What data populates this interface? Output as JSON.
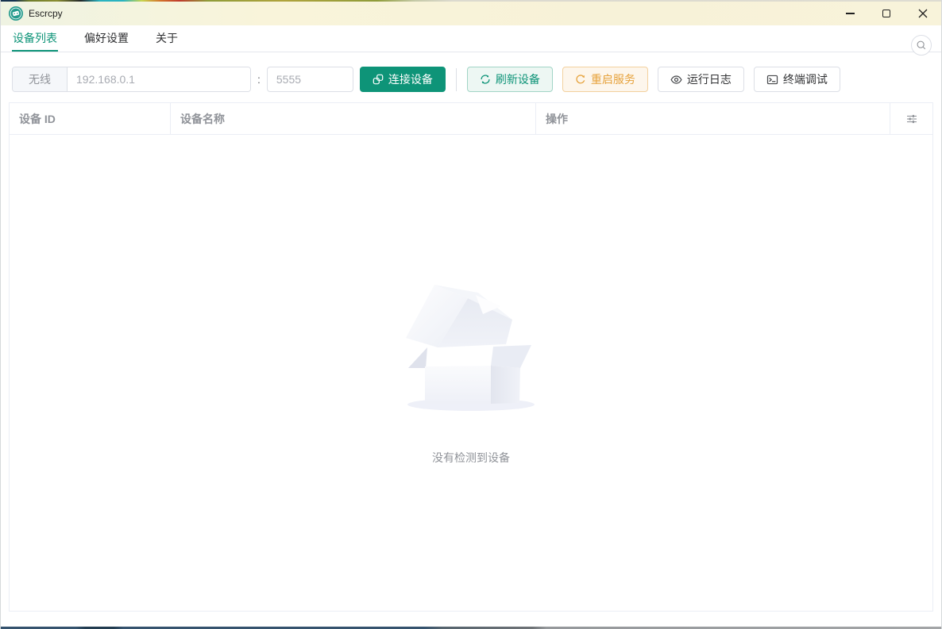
{
  "window": {
    "title": "Escrcpy"
  },
  "tabs": [
    {
      "label": "设备列表",
      "active": true
    },
    {
      "label": "偏好设置",
      "active": false
    },
    {
      "label": "关于",
      "active": false
    }
  ],
  "toolbar": {
    "wireless_label": "无线",
    "ip_value": "192.168.0.1",
    "port_separator": ":",
    "port_value": "5555",
    "connect_label": "连接设备",
    "refresh_label": "刷新设备",
    "restart_label": "重启服务",
    "logs_label": "运行日志",
    "terminal_label": "终端调试"
  },
  "table": {
    "columns": [
      {
        "label": "设备 ID"
      },
      {
        "label": "设备名称"
      },
      {
        "label": "操作"
      }
    ]
  },
  "empty_state": {
    "description": "没有检测到设备"
  },
  "icons": {
    "app_logo": "escrcpy-logo",
    "connect": "link-icon",
    "refresh": "refresh-arrows-icon",
    "restart": "refresh-right-icon",
    "logs": "eye-icon",
    "terminal": "terminal-window-icon",
    "search": "magnifier-icon",
    "column_settings": "sliders-icon"
  },
  "colors": {
    "primary": "#0e9478",
    "success_bg": "#edf7f3",
    "success_border": "#a2d5c6",
    "warning": "#e6a23c",
    "warning_border": "#f3d19e",
    "warning_bg": "#fdf6ec",
    "titlebar_bg": "#f7f2d8",
    "header_text": "#909399",
    "border": "#dcdfe6"
  }
}
